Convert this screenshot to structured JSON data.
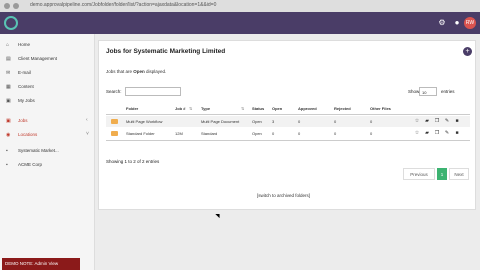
{
  "browser": {
    "url": "demo.approvalpipeline.com/Jobfolder/folder/list/?action=ajaxdata&location=1&&id=0"
  },
  "appbar": {
    "avatar_initials": "RW"
  },
  "sidebar": {
    "items": [
      {
        "label": "Home",
        "icon": "home-icon",
        "active": false
      },
      {
        "label": "Client Management",
        "icon": "clipboard-icon",
        "active": false
      },
      {
        "label": "E-mail",
        "icon": "mail-icon",
        "active": false
      },
      {
        "label": "Content",
        "icon": "content-icon",
        "active": false
      },
      {
        "label": "My Jobs",
        "icon": "jobs-icon",
        "active": false
      },
      {
        "label": "Jobs",
        "icon": "jobs-icon",
        "active": true
      },
      {
        "label": "Locations",
        "icon": "location-icon",
        "active": true
      },
      {
        "label": "Systematic Market...",
        "icon": "folder-icon",
        "active": false
      },
      {
        "label": "ACME Corp",
        "icon": "folder-icon",
        "active": false
      }
    ],
    "demo_note": "DEMO NOTE: Admin View"
  },
  "panel": {
    "title": "Jobs for Systematic Marketing Limited",
    "desc_prefix": "Jobs that are ",
    "desc_bold": "Open",
    "desc_suffix": " displayed.",
    "search_label": "Search:",
    "show_label": "Show",
    "show_value": "10",
    "entries_label": "entries",
    "columns": [
      "Folder",
      "Job #",
      "Type",
      "Status",
      "Open",
      "Approved",
      "Rejected",
      "Other Files"
    ],
    "rows": [
      {
        "folder": "Multi Page Workflow",
        "job": "",
        "type": "Multi Page Document",
        "status": "Open",
        "open": "3",
        "approved": "0",
        "rejected": "0",
        "other": "0"
      },
      {
        "folder": "Standard Folder",
        "job": "12M",
        "type": "Standard",
        "status": "Open",
        "open": "0",
        "approved": "0",
        "rejected": "0",
        "other": "0"
      }
    ],
    "showing": "Showing 1 to 2 of 2 entries",
    "pagination": {
      "previous": "Previous",
      "current": "1",
      "next": "Next"
    },
    "archived_link": "[switch to archived folders]"
  },
  "colors": {
    "appbar": "#4a3d67",
    "accent_green": "#3cb371",
    "folder": "#f0ad4e",
    "avatar": "#d9534f"
  }
}
